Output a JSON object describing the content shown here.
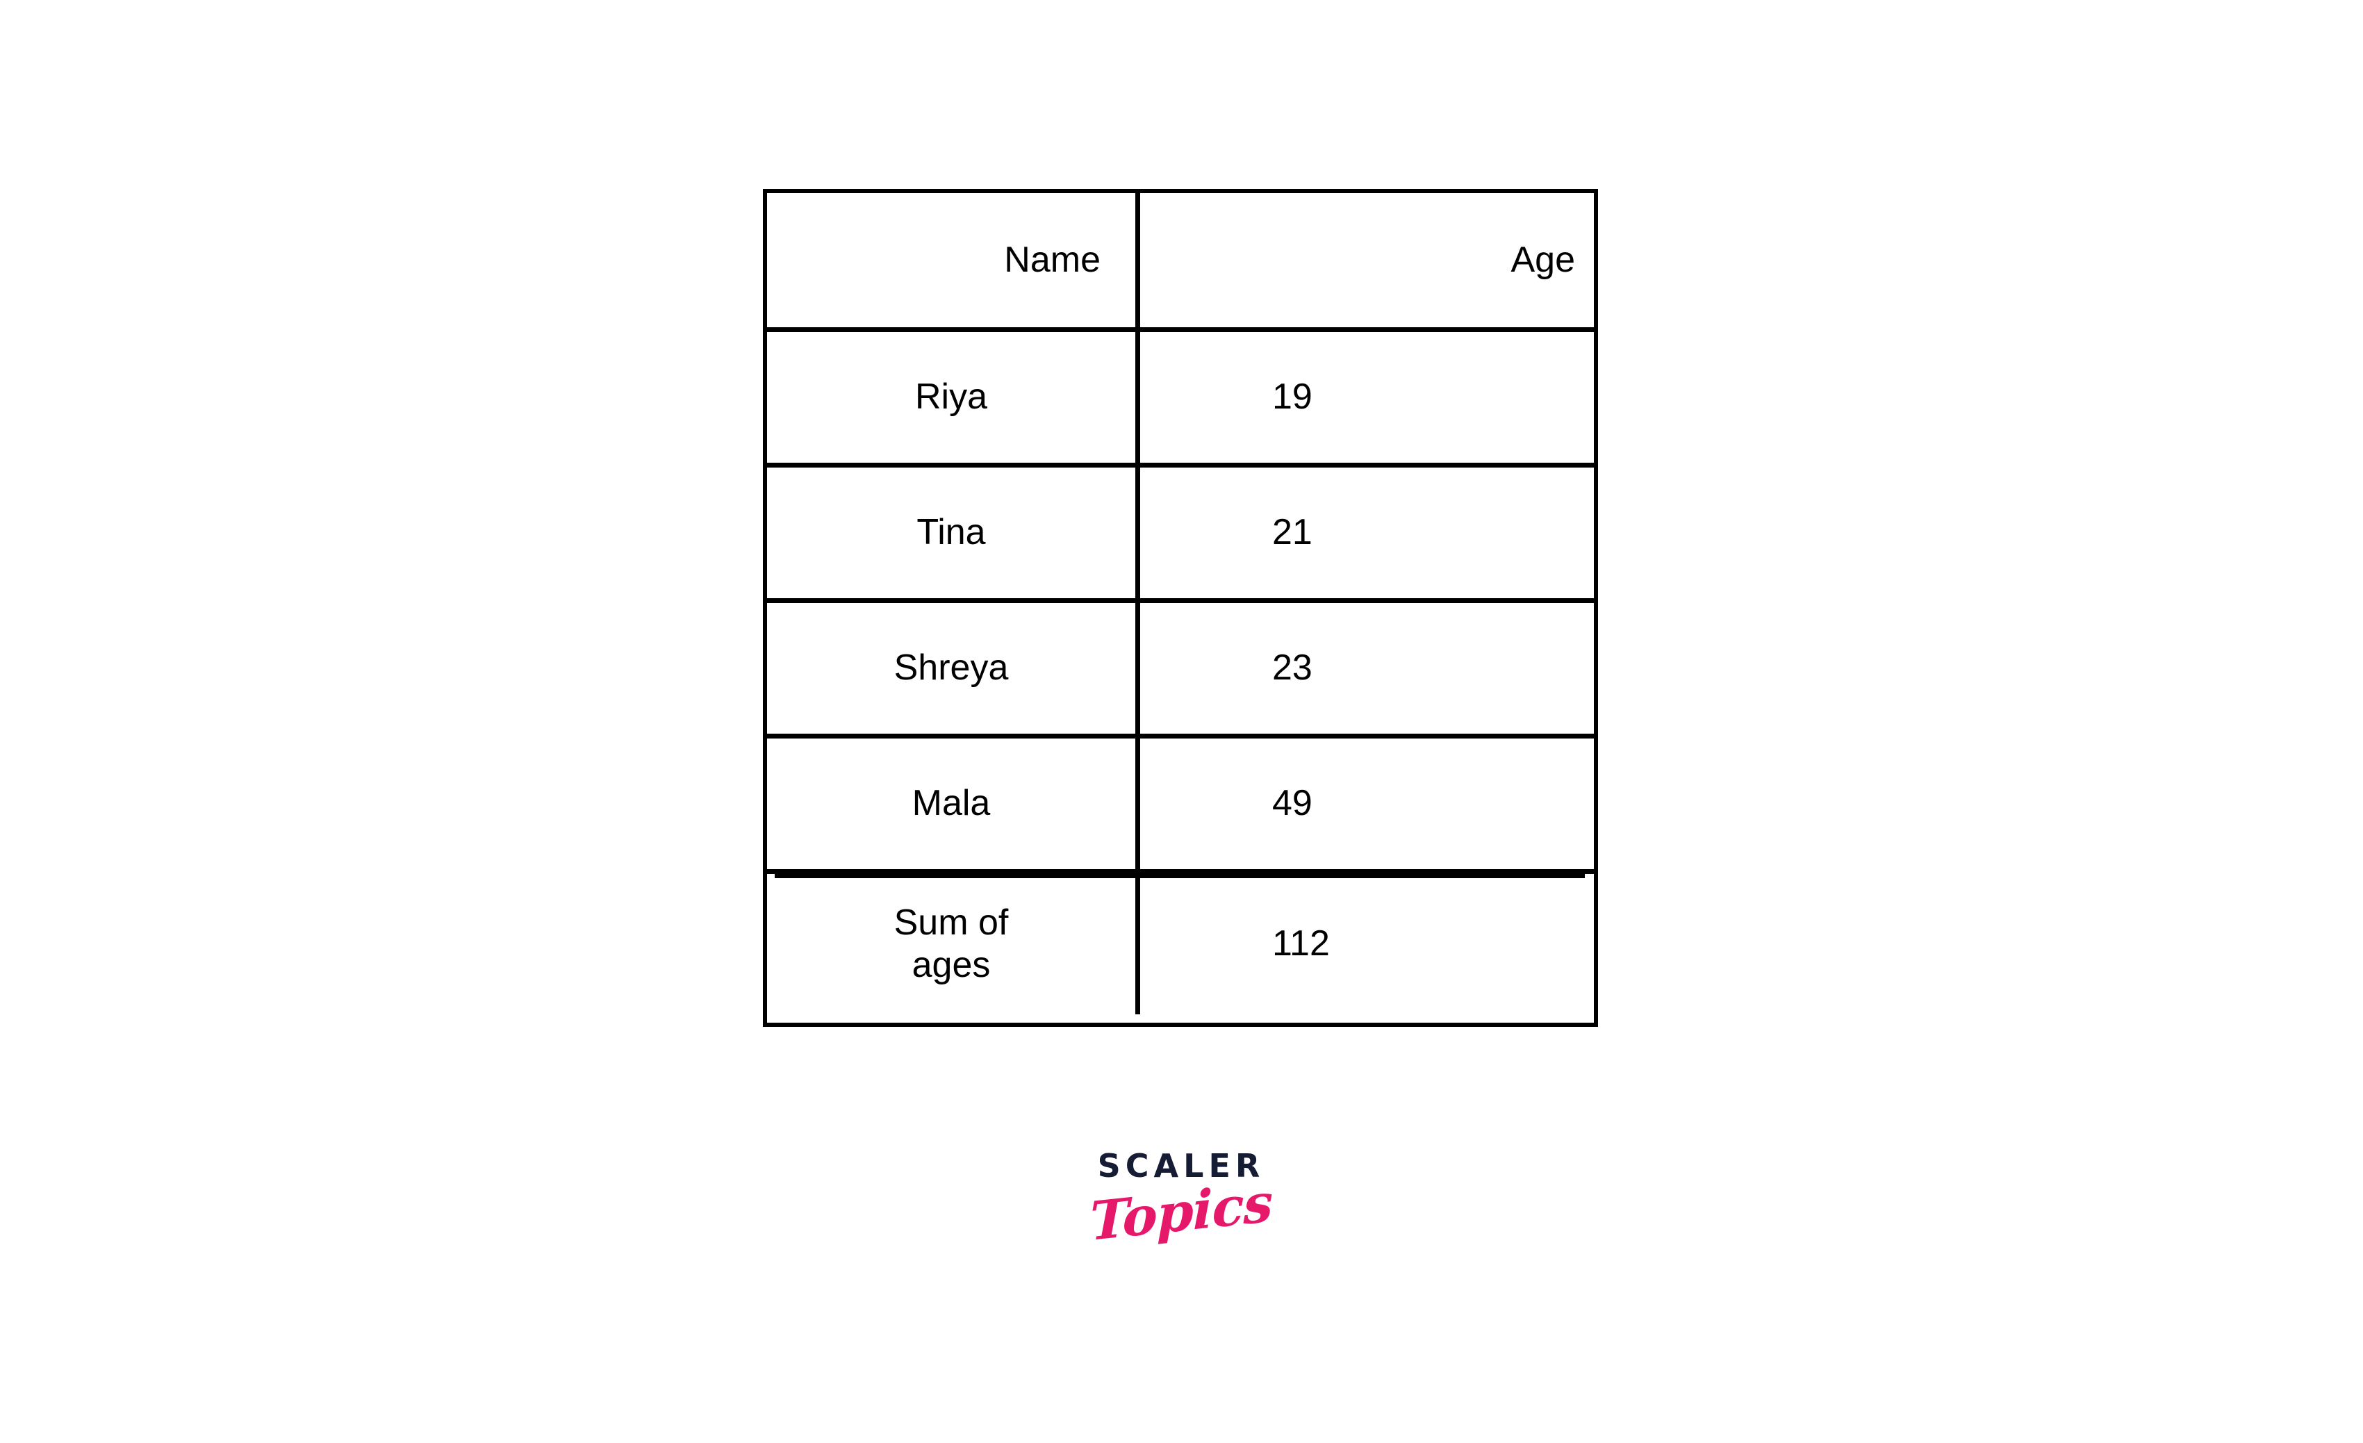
{
  "table": {
    "columns": [
      "Name",
      "Age"
    ],
    "rows": [
      {
        "name": "Riya",
        "age": "19"
      },
      {
        "name": "Tina",
        "age": "21"
      },
      {
        "name": "Shreya",
        "age": "23"
      },
      {
        "name": "Mala",
        "age": "49"
      }
    ],
    "total": {
      "name": "Sum of\nages",
      "age": "112"
    }
  },
  "logo": {
    "primary": "SCALER",
    "secondary": "Topics",
    "primary_color": "#151c33",
    "secondary_color": "#e5186a"
  },
  "colors": {
    "background": "#ffffff",
    "border": "#000000",
    "text": "#000000"
  }
}
